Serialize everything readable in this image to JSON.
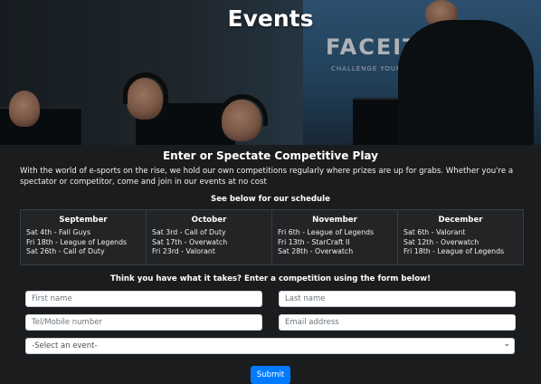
{
  "hero": {
    "title": "Events",
    "banner_text": "FACEIT",
    "banner_sub": "CHALLENGE YOUR GAME"
  },
  "intro": {
    "heading": "Enter or Spectate Competitive Play",
    "body": "With the world of e-sports on the rise, we hold our own competitions regularly where prizes are up for grabs. Whether you're a spectator or competitor, come and join in our events at no cost"
  },
  "schedule": {
    "heading": "See below for our schedule",
    "months": [
      {
        "name": "September",
        "events": [
          "Sat 4th - Fall Guys",
          "Fri 18th - League of Legends",
          "Sat 26th - Call of Duty"
        ]
      },
      {
        "name": "October",
        "events": [
          "Sat 3rd - Call of Duty",
          "Sat 17th - Overwatch",
          "Fri 23rd - Valorant"
        ]
      },
      {
        "name": "November",
        "events": [
          "Fri 6th - League of Legends",
          "Fri 13th - StarCraft II",
          "Sat 28th - Overwatch"
        ]
      },
      {
        "name": "December",
        "events": [
          "Sat 6th - Valorant",
          "Sat 12th - Overwatch",
          "Fri 18th - League of Legends"
        ]
      }
    ]
  },
  "form": {
    "heading": "Think you have what it takes? Enter a competition using the form below!",
    "first_name_placeholder": "First name",
    "last_name_placeholder": "Last name",
    "phone_placeholder": "Tel/Mobile number",
    "email_placeholder": "Email address",
    "event_select_value": "-Select an event-",
    "submit_label": "Submit"
  },
  "colors": {
    "background": "#1b1c1e",
    "submit_button": "#007bff"
  }
}
